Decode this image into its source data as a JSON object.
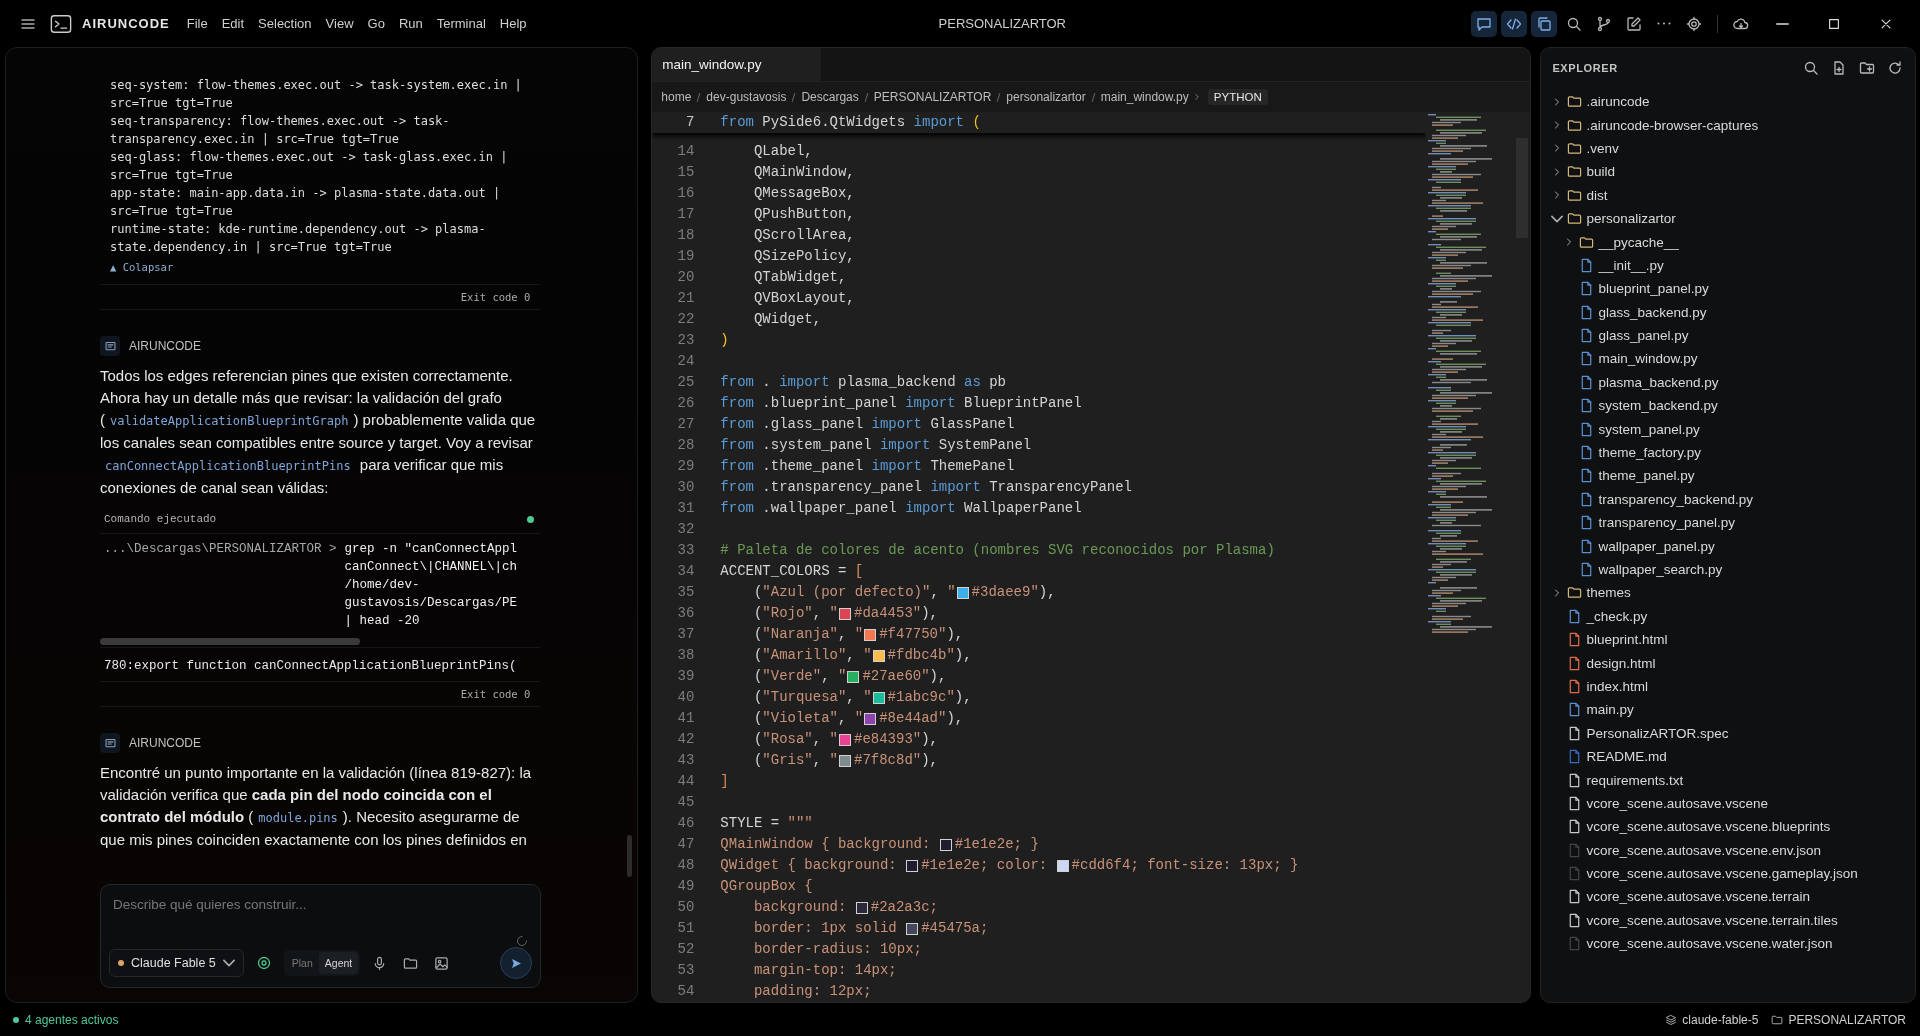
{
  "titlebar": {
    "app_name": "AIRUNCODE",
    "menu": [
      "File",
      "Edit",
      "Selection",
      "View",
      "Go",
      "Run",
      "Terminal",
      "Help"
    ],
    "title": "PERSONALIZARTOR",
    "tools": [
      {
        "kind": "chat",
        "on": true
      },
      {
        "kind": "code",
        "on": true
      },
      {
        "kind": "copy",
        "on": true
      },
      {
        "kind": "search",
        "on": false
      },
      {
        "kind": "branch",
        "on": false
      },
      {
        "kind": "edit",
        "on": false
      },
      {
        "kind": "more",
        "on": false
      },
      {
        "kind": "settings",
        "on": false
      },
      {
        "kind": "cloud",
        "on": false
      }
    ],
    "window_controls": [
      {
        "kind": "minimize"
      },
      {
        "kind": "maximize"
      },
      {
        "kind": "close"
      }
    ]
  },
  "chat": {
    "messages": [
      {
        "kind": "output",
        "lines": [
          "seq-system: flow-themes.exec.out -> task-system.exec.in | src=True tgt=True",
          "seq-transparency: flow-themes.exec.out -> task-transparency.exec.in | src=True tgt=True",
          "seq-glass: flow-themes.exec.out -> task-glass.exec.in | src=True tgt=True",
          "app-state: main-app.data.in -> plasma-state.data.out | src=True tgt=True",
          "runtime-state: kde-runtime.dependency.out -> plasma-state.dependency.in | src=True tgt=True"
        ],
        "collapse_label": "▲ Colapsar",
        "exit": "Exit code 0"
      },
      {
        "kind": "message",
        "author": "AIRUNCODE",
        "segments": [
          {
            "kind": "text",
            "text": "Todos los edges referencian pines que existen correctamente. Ahora hay un detalle más que revisar: la validación del grafo ("
          },
          {
            "kind": "code",
            "text": "validateApplicationBlueprintGraph"
          },
          {
            "kind": "text",
            "text": ") probablemente valida que los canales sean compatibles entre source y target. Voy a revisar "
          },
          {
            "kind": "code",
            "text": "canConnectApplicationBlueprintPins"
          },
          {
            "kind": "text",
            "text": " para verificar que mis conexiones de canal sean válidas:"
          }
        ]
      },
      {
        "kind": "command",
        "title": "Comando ejecutado",
        "color": "#4ec98f",
        "prompt": "...\\Descargas\\PERSONALIZARTOR >",
        "command_lines": [
          "grep -n \"canConnectAppl",
          "canConnect\\|CHANNEL\\|ch",
          "/home/dev-",
          "gustavosis/Descargas/PE",
          "| head -20"
        ],
        "output": "780:export function canConnectApplicationBlueprintPins(",
        "exit": "Exit code 0"
      },
      {
        "kind": "message",
        "author": "AIRUNCODE",
        "segments": [
          {
            "kind": "text",
            "text": "Encontré un punto importante en la validación (línea 819-827): la validación verifica que **cada pin del nodo coincida con el contrato del módulo** ("
          },
          {
            "kind": "code",
            "text": "module.pins"
          },
          {
            "kind": "text",
            "text": "). Necesito asegurarme de que mis pines coinciden exactamente con los pines definidos en"
          }
        ]
      }
    ],
    "input": {
      "placeholder": "Describe qué quieres construir...",
      "model": "Claude Fable 5",
      "modes": [
        {
          "label": "Plan",
          "selected": false
        },
        {
          "label": "Agent",
          "selected": true
        }
      ]
    }
  },
  "editor": {
    "tabs": [
      {
        "label": "main_window.py",
        "selected": true
      }
    ],
    "breadcrumb": [
      "home",
      "dev-gustavosis",
      "Descargas",
      "PERSONALIZARTOR",
      "personalizartor",
      "main_window.py"
    ],
    "language": "PYTHON",
    "sticky": {
      "num": "7",
      "tokens": [
        {
          "kind": "kw",
          "text": "from"
        },
        {
          "kind": "p",
          "text": " PySide6.QtWidgets "
        },
        {
          "kind": "kw",
          "text": "import"
        },
        {
          "kind": "br",
          "text": " ("
        }
      ]
    },
    "lines": [
      {
        "num": "14",
        "tokens": [
          {
            "kind": "p",
            "text": "    QLabel,"
          }
        ]
      },
      {
        "num": "15",
        "tokens": [
          {
            "kind": "p",
            "text": "    QMainWindow,"
          }
        ]
      },
      {
        "num": "16",
        "tokens": [
          {
            "kind": "p",
            "text": "    QMessageBox,"
          }
        ]
      },
      {
        "num": "17",
        "tokens": [
          {
            "kind": "p",
            "text": "    QPushButton,"
          }
        ]
      },
      {
        "num": "18",
        "tokens": [
          {
            "kind": "p",
            "text": "    QScrollArea,"
          }
        ]
      },
      {
        "num": "19",
        "tokens": [
          {
            "kind": "p",
            "text": "    QSizePolicy,"
          }
        ]
      },
      {
        "num": "20",
        "tokens": [
          {
            "kind": "p",
            "text": "    QTabWidget,"
          }
        ]
      },
      {
        "num": "21",
        "tokens": [
          {
            "kind": "p",
            "text": "    QVBoxLayout,"
          }
        ]
      },
      {
        "num": "22",
        "tokens": [
          {
            "kind": "p",
            "text": "    QWidget,"
          }
        ]
      },
      {
        "num": "23",
        "tokens": [
          {
            "kind": "br",
            "text": ")"
          }
        ]
      },
      {
        "num": "24"
      },
      {
        "num": "25",
        "tokens": [
          {
            "kind": "kw",
            "text": "from"
          },
          {
            "kind": "p",
            "text": " . "
          },
          {
            "kind": "kw",
            "text": "import"
          },
          {
            "kind": "p",
            "text": " plasma_backend "
          },
          {
            "kind": "kw",
            "text": "as"
          },
          {
            "kind": "p",
            "text": " pb"
          }
        ]
      },
      {
        "num": "26",
        "tokens": [
          {
            "kind": "kw",
            "text": "from"
          },
          {
            "kind": "p",
            "text": " .blueprint_panel "
          },
          {
            "kind": "kw",
            "text": "import"
          },
          {
            "kind": "p",
            "text": " BlueprintPanel"
          }
        ]
      },
      {
        "num": "27",
        "tokens": [
          {
            "kind": "kw",
            "text": "from"
          },
          {
            "kind": "p",
            "text": " .glass_panel "
          },
          {
            "kind": "kw",
            "text": "import"
          },
          {
            "kind": "p",
            "text": " GlassPanel"
          }
        ]
      },
      {
        "num": "28",
        "tokens": [
          {
            "kind": "kw",
            "text": "from"
          },
          {
            "kind": "p",
            "text": " .system_panel "
          },
          {
            "kind": "kw",
            "text": "import"
          },
          {
            "kind": "p",
            "text": " SystemPanel"
          }
        ]
      },
      {
        "num": "29",
        "tokens": [
          {
            "kind": "kw",
            "text": "from"
          },
          {
            "kind": "p",
            "text": " .theme_panel "
          },
          {
            "kind": "kw",
            "text": "import"
          },
          {
            "kind": "p",
            "text": " ThemePanel"
          }
        ]
      },
      {
        "num": "30",
        "tokens": [
          {
            "kind": "kw",
            "text": "from"
          },
          {
            "kind": "p",
            "text": " .transparency_panel "
          },
          {
            "kind": "kw",
            "text": "import"
          },
          {
            "kind": "p",
            "text": " TransparencyPanel"
          }
        ]
      },
      {
        "num": "31",
        "tokens": [
          {
            "kind": "kw",
            "text": "from"
          },
          {
            "kind": "p",
            "text": " .wallpaper_panel "
          },
          {
            "kind": "kw",
            "text": "import"
          },
          {
            "kind": "p",
            "text": " WallpaperPanel"
          }
        ]
      },
      {
        "num": "32"
      },
      {
        "num": "33",
        "tokens": [
          {
            "kind": "cm",
            "text": "# Paleta de colores de acento (nombres SVG reconocidos por Plasma)"
          }
        ]
      },
      {
        "num": "34",
        "tokens": [
          {
            "kind": "p",
            "text": "ACCENT_COLORS = "
          },
          {
            "kind": "br2",
            "text": "["
          }
        ]
      },
      {
        "num": "35",
        "tokens": [
          {
            "kind": "p",
            "text": "    ("
          },
          {
            "kind": "s",
            "text": "\"Azul (por defecto)\""
          },
          {
            "kind": "p",
            "text": ", "
          },
          {
            "kind": "s",
            "text": "\""
          },
          {
            "kind": "swatch",
            "color": "#3daee9"
          },
          {
            "kind": "s",
            "text": "#3daee9\""
          },
          {
            "kind": "p",
            "text": "),"
          }
        ]
      },
      {
        "num": "36",
        "tokens": [
          {
            "kind": "p",
            "text": "    ("
          },
          {
            "kind": "s",
            "text": "\"Rojo\""
          },
          {
            "kind": "p",
            "text": ", "
          },
          {
            "kind": "s",
            "text": "\""
          },
          {
            "kind": "swatch",
            "color": "#da4453"
          },
          {
            "kind": "s",
            "text": "#da4453\""
          },
          {
            "kind": "p",
            "text": "),"
          }
        ]
      },
      {
        "num": "37",
        "tokens": [
          {
            "kind": "p",
            "text": "    ("
          },
          {
            "kind": "s",
            "text": "\"Naranja\""
          },
          {
            "kind": "p",
            "text": ", "
          },
          {
            "kind": "s",
            "text": "\""
          },
          {
            "kind": "swatch",
            "color": "#f47750"
          },
          {
            "kind": "s",
            "text": "#f47750\""
          },
          {
            "kind": "p",
            "text": "),"
          }
        ]
      },
      {
        "num": "38",
        "tokens": [
          {
            "kind": "p",
            "text": "    ("
          },
          {
            "kind": "s",
            "text": "\"Amarillo\""
          },
          {
            "kind": "p",
            "text": ", "
          },
          {
            "kind": "s",
            "text": "\""
          },
          {
            "kind": "swatch",
            "color": "#fdbc4b"
          },
          {
            "kind": "s",
            "text": "#fdbc4b\""
          },
          {
            "kind": "p",
            "text": "),"
          }
        ]
      },
      {
        "num": "39",
        "tokens": [
          {
            "kind": "p",
            "text": "    ("
          },
          {
            "kind": "s",
            "text": "\"Verde\""
          },
          {
            "kind": "p",
            "text": ", "
          },
          {
            "kind": "s",
            "text": "\""
          },
          {
            "kind": "swatch",
            "color": "#27ae60"
          },
          {
            "kind": "s",
            "text": "#27ae60\""
          },
          {
            "kind": "p",
            "text": "),"
          }
        ]
      },
      {
        "num": "40",
        "tokens": [
          {
            "kind": "p",
            "text": "    ("
          },
          {
            "kind": "s",
            "text": "\"Turquesa\""
          },
          {
            "kind": "p",
            "text": ", "
          },
          {
            "kind": "s",
            "text": "\""
          },
          {
            "kind": "swatch",
            "color": "#1abc9c"
          },
          {
            "kind": "s",
            "text": "#1abc9c\""
          },
          {
            "kind": "p",
            "text": "),"
          }
        ]
      },
      {
        "num": "41",
        "tokens": [
          {
            "kind": "p",
            "text": "    ("
          },
          {
            "kind": "s",
            "text": "\"Violeta\""
          },
          {
            "kind": "p",
            "text": ", "
          },
          {
            "kind": "s",
            "text": "\""
          },
          {
            "kind": "swatch",
            "color": "#8e44ad"
          },
          {
            "kind": "s",
            "text": "#8e44ad\""
          },
          {
            "kind": "p",
            "text": "),"
          }
        ]
      },
      {
        "num": "42",
        "tokens": [
          {
            "kind": "p",
            "text": "    ("
          },
          {
            "kind": "s",
            "text": "\"Rosa\""
          },
          {
            "kind": "p",
            "text": ", "
          },
          {
            "kind": "s",
            "text": "\""
          },
          {
            "kind": "swatch",
            "color": "#e84393"
          },
          {
            "kind": "s",
            "text": "#e84393\""
          },
          {
            "kind": "p",
            "text": "),"
          }
        ]
      },
      {
        "num": "43",
        "tokens": [
          {
            "kind": "p",
            "text": "    ("
          },
          {
            "kind": "s",
            "text": "\"Gris\""
          },
          {
            "kind": "p",
            "text": ", "
          },
          {
            "kind": "s",
            "text": "\""
          },
          {
            "kind": "swatch",
            "color": "#7f8c8d"
          },
          {
            "kind": "s",
            "text": "#7f8c8d\""
          },
          {
            "kind": "p",
            "text": "),"
          }
        ]
      },
      {
        "num": "44",
        "tokens": [
          {
            "kind": "br2",
            "text": "]"
          }
        ]
      },
      {
        "num": "45"
      },
      {
        "num": "46",
        "tokens": [
          {
            "kind": "p",
            "text": "STYLE = "
          },
          {
            "kind": "s",
            "text": "\"\"\""
          }
        ]
      },
      {
        "num": "47",
        "tokens": [
          {
            "kind": "s",
            "text": "QMainWindow { background: "
          },
          {
            "kind": "swatch",
            "color": "#1e1e2e"
          },
          {
            "kind": "s",
            "text": "#1e1e2e; }"
          }
        ]
      },
      {
        "num": "48",
        "tokens": [
          {
            "kind": "s",
            "text": "QWidget { background: "
          },
          {
            "kind": "swatch",
            "color": "#1e1e2e"
          },
          {
            "kind": "s",
            "text": "#1e1e2e; color: "
          },
          {
            "kind": "swatch",
            "color": "#cdd6f4"
          },
          {
            "kind": "s",
            "text": "#cdd6f4; font-size: 13px; }"
          }
        ]
      },
      {
        "num": "49",
        "tokens": [
          {
            "kind": "s",
            "text": "QGroupBox {"
          }
        ]
      },
      {
        "num": "50",
        "tokens": [
          {
            "kind": "s",
            "text": "    background: "
          },
          {
            "kind": "swatch",
            "color": "#2a2a3c"
          },
          {
            "kind": "s",
            "text": "#2a2a3c;"
          }
        ]
      },
      {
        "num": "51",
        "tokens": [
          {
            "kind": "s",
            "text": "    border: 1px solid "
          },
          {
            "kind": "swatch",
            "color": "#45475a"
          },
          {
            "kind": "s",
            "text": "#45475a;"
          }
        ]
      },
      {
        "num": "52",
        "tokens": [
          {
            "kind": "s",
            "text": "    border-radius: 10px;"
          }
        ]
      },
      {
        "num": "53",
        "tokens": [
          {
            "kind": "s",
            "text": "    margin-top: 14px;"
          }
        ]
      },
      {
        "num": "54",
        "tokens": [
          {
            "kind": "s",
            "text": "    padding: 12px;"
          }
        ]
      }
    ]
  },
  "explorer": {
    "title": "EXPLORER",
    "items": [
      {
        "kind": "folder",
        "label": ".airuncode",
        "expanded": false
      },
      {
        "kind": "folder",
        "label": ".airuncode-browser-captures",
        "expanded": false
      },
      {
        "kind": "folder",
        "label": ".venv",
        "expanded": false
      },
      {
        "kind": "folder",
        "label": "build",
        "expanded": false
      },
      {
        "kind": "folder",
        "label": "dist",
        "expanded": false
      },
      {
        "kind": "folder",
        "label": "personalizartor",
        "expanded": true,
        "children": [
          {
            "kind": "folder",
            "label": "__pycache__",
            "expanded": false
          },
          {
            "kind": "py",
            "label": "__init__.py"
          },
          {
            "kind": "py",
            "label": "blueprint_panel.py"
          },
          {
            "kind": "py",
            "label": "glass_backend.py"
          },
          {
            "kind": "py",
            "label": "glass_panel.py"
          },
          {
            "kind": "py",
            "label": "main_window.py"
          },
          {
            "kind": "py",
            "label": "plasma_backend.py"
          },
          {
            "kind": "py",
            "label": "system_backend.py"
          },
          {
            "kind": "py",
            "label": "system_panel.py"
          },
          {
            "kind": "py",
            "label": "theme_factory.py"
          },
          {
            "kind": "py",
            "label": "theme_panel.py"
          },
          {
            "kind": "py",
            "label": "transparency_backend.py"
          },
          {
            "kind": "py",
            "label": "transparency_panel.py"
          },
          {
            "kind": "py",
            "label": "wallpaper_panel.py"
          },
          {
            "kind": "py",
            "label": "wallpaper_search.py"
          }
        ]
      },
      {
        "kind": "folder",
        "label": "themes",
        "expanded": false
      },
      {
        "kind": "py",
        "label": "_check.py"
      },
      {
        "kind": "html",
        "label": "blueprint.html"
      },
      {
        "kind": "html",
        "label": "design.html"
      },
      {
        "kind": "html",
        "label": "index.html"
      },
      {
        "kind": "py",
        "label": "main.py"
      },
      {
        "kind": "plain",
        "label": "PersonalizARTOR.spec"
      },
      {
        "kind": "md",
        "label": "README.md"
      },
      {
        "kind": "plain",
        "label": "requirements.txt"
      },
      {
        "kind": "plain",
        "label": "vcore_scene.autosave.vscene"
      },
      {
        "kind": "plain",
        "label": "vcore_scene.autosave.vscene.blueprints"
      },
      {
        "kind": "faint",
        "label": "vcore_scene.autosave.vscene.env.json"
      },
      {
        "kind": "faint",
        "label": "vcore_scene.autosave.vscene.gameplay.json"
      },
      {
        "kind": "plain",
        "label": "vcore_scene.autosave.vscene.terrain"
      },
      {
        "kind": "plain",
        "label": "vcore_scene.autosave.vscene.terrain.tiles"
      },
      {
        "kind": "faint",
        "label": "vcore_scene.autosave.vscene.water.json"
      }
    ]
  },
  "status_bar": {
    "agents": "4 agentes activos",
    "model": "claude-fable-5",
    "project": "PERSONALIZARTOR"
  }
}
